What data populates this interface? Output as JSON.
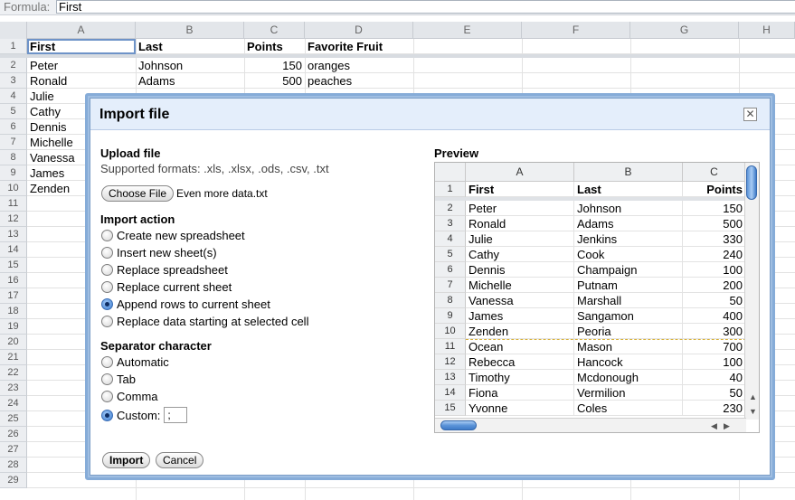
{
  "formula_bar": {
    "label": "Formula:",
    "value": "First"
  },
  "sheet": {
    "columns": [
      "A",
      "B",
      "C",
      "D",
      "E",
      "F",
      "G",
      "H"
    ],
    "rows": [
      "1",
      "2",
      "3",
      "4",
      "5",
      "6",
      "7",
      "8",
      "9",
      "10",
      "11",
      "12",
      "13",
      "14",
      "15",
      "16",
      "17",
      "18",
      "19",
      "20",
      "21",
      "22",
      "23",
      "24",
      "25",
      "26",
      "27",
      "28",
      "29"
    ],
    "header_row": [
      "First",
      "Last",
      "Points",
      "Favorite Fruit"
    ],
    "data": [
      [
        "Peter",
        "Johnson",
        "150",
        "oranges"
      ],
      [
        "Ronald",
        "Adams",
        "500",
        "peaches"
      ],
      [
        "Julie",
        "",
        "",
        ""
      ],
      [
        "Cathy",
        "",
        "",
        ""
      ],
      [
        "Dennis",
        "",
        "",
        ""
      ],
      [
        "Michelle",
        "",
        "",
        ""
      ],
      [
        "Vanessa",
        "",
        "",
        ""
      ],
      [
        "James",
        "",
        "",
        ""
      ],
      [
        "Zenden",
        "",
        "",
        ""
      ]
    ]
  },
  "dialog": {
    "title": "Import file",
    "close_icon": "close-icon",
    "upload": {
      "title": "Upload file",
      "formats": "Supported formats: .xls, .xlsx, .ods, .csv, .txt",
      "choose_label": "Choose File",
      "file_name": "Even more data.txt"
    },
    "import_action": {
      "title": "Import action",
      "options": [
        "Create new spreadsheet",
        "Insert new sheet(s)",
        "Replace spreadsheet",
        "Replace current sheet",
        "Append rows to current sheet",
        "Replace data starting at selected cell"
      ],
      "selected": "Append rows to current sheet"
    },
    "separator": {
      "title": "Separator character",
      "options": [
        "Automatic",
        "Tab",
        "Comma",
        "Custom:"
      ],
      "selected": "Custom:",
      "custom_value": ";"
    },
    "import_label": "Import",
    "cancel_label": "Cancel",
    "preview": {
      "title": "Preview",
      "columns": [
        "A",
        "B",
        "C"
      ],
      "rows": [
        [
          "1",
          "First",
          "Last",
          "Points"
        ],
        [
          "2",
          "Peter",
          "Johnson",
          "150"
        ],
        [
          "3",
          "Ronald",
          "Adams",
          "500"
        ],
        [
          "4",
          "Julie",
          "Jenkins",
          "330"
        ],
        [
          "5",
          "Cathy",
          "Cook",
          "240"
        ],
        [
          "6",
          "Dennis",
          "Champaign",
          "100"
        ],
        [
          "7",
          "Michelle",
          "Putnam",
          "200"
        ],
        [
          "8",
          "Vanessa",
          "Marshall",
          "50"
        ],
        [
          "9",
          "James",
          "Sangamon",
          "400"
        ],
        [
          "10",
          "Zenden",
          "Peoria",
          "300"
        ],
        [
          "11",
          "Ocean",
          "Mason",
          "700"
        ],
        [
          "12",
          "Rebecca",
          "Hancock",
          "100"
        ],
        [
          "13",
          "Timothy",
          "Mcdonough",
          "40"
        ],
        [
          "14",
          "Fiona",
          "Vermilion",
          "50"
        ],
        [
          "15",
          "Yvonne",
          "Coles",
          "230"
        ]
      ]
    }
  }
}
